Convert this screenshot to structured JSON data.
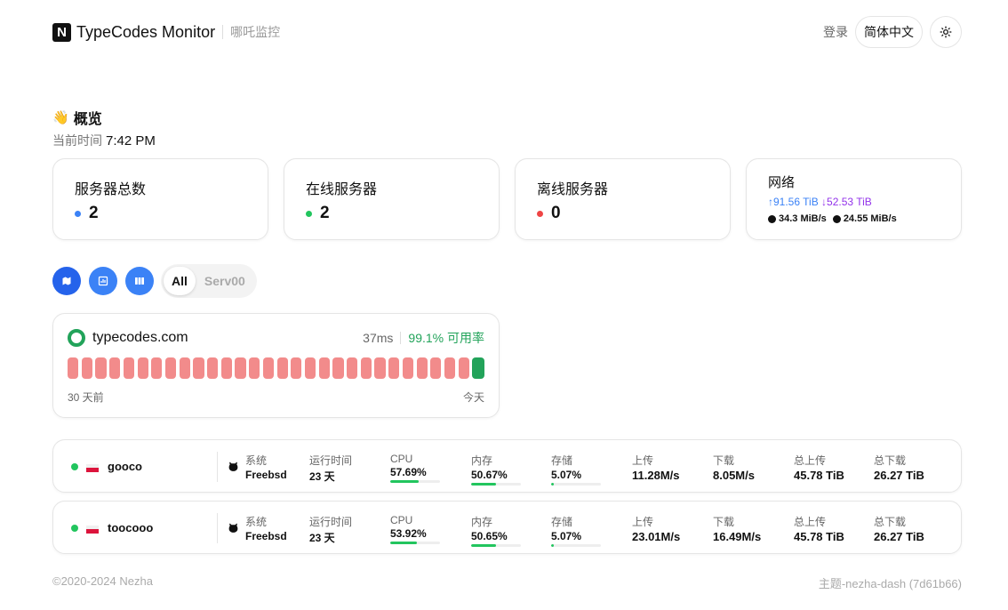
{
  "header": {
    "logo_letter": "N",
    "title": "TypeCodes Monitor",
    "subtitle": "哪吒监控",
    "login": "登录",
    "language": "简体中文"
  },
  "overview": {
    "emoji": "👋",
    "title": "概览",
    "time_label": "当前时间",
    "time_value": "7:42 PM"
  },
  "stats": {
    "total": {
      "label": "服务器总数",
      "value": "2",
      "color": "#3b82f6"
    },
    "online": {
      "label": "在线服务器",
      "value": "2",
      "color": "#22c55e"
    },
    "offline": {
      "label": "离线服务器",
      "value": "0",
      "color": "#ef4444"
    },
    "network": {
      "label": "网络",
      "upload_total": "↑91.56 TiB",
      "download_total": "↓52.53 TiB",
      "upload_speed": "34.3 MiB/s",
      "download_speed": "24.55 MiB/s",
      "upload_color": "#3b82f6",
      "download_color": "#9333ea"
    }
  },
  "toolbar": {
    "accent": "#3b82f6",
    "filters": [
      "All",
      "Serv00"
    ]
  },
  "service": {
    "name": "typecodes.com",
    "latency": "37ms",
    "uptime": "99.1% 可用率",
    "start_label": "30 天前",
    "end_label": "今天",
    "days_down": 29,
    "days_up": 1
  },
  "servers": [
    {
      "name": "gooco",
      "system_label": "系统",
      "system": "Freebsd",
      "uptime_label": "运行时间",
      "uptime": "23 天",
      "cpu_label": "CPU",
      "cpu": "57.69%",
      "cpu_pct": 57.69,
      "mem_label": "内存",
      "mem": "50.67%",
      "mem_pct": 50.67,
      "disk_label": "存储",
      "disk": "5.07%",
      "disk_pct": 5.07,
      "up_label": "上传",
      "up": "11.28M/s",
      "down_label": "下载",
      "down": "8.05M/s",
      "total_up_label": "总上传",
      "total_up": "45.78 TiB",
      "total_down_label": "总下载",
      "total_down": "26.27 TiB"
    },
    {
      "name": "toocooo",
      "system_label": "系统",
      "system": "Freebsd",
      "uptime_label": "运行时间",
      "uptime": "23 天",
      "cpu_label": "CPU",
      "cpu": "53.92%",
      "cpu_pct": 53.92,
      "mem_label": "内存",
      "mem": "50.65%",
      "mem_pct": 50.65,
      "disk_label": "存储",
      "disk": "5.07%",
      "disk_pct": 5.07,
      "up_label": "上传",
      "up": "23.01M/s",
      "down_label": "下载",
      "down": "16.49M/s",
      "total_up_label": "总上传",
      "total_up": "45.78 TiB",
      "total_down_label": "总下载",
      "total_down": "26.27 TiB"
    }
  ],
  "footer": {
    "copyright": "©2020-2024 Nezha",
    "theme": "主题-nezha-dash (7d61b66)"
  }
}
